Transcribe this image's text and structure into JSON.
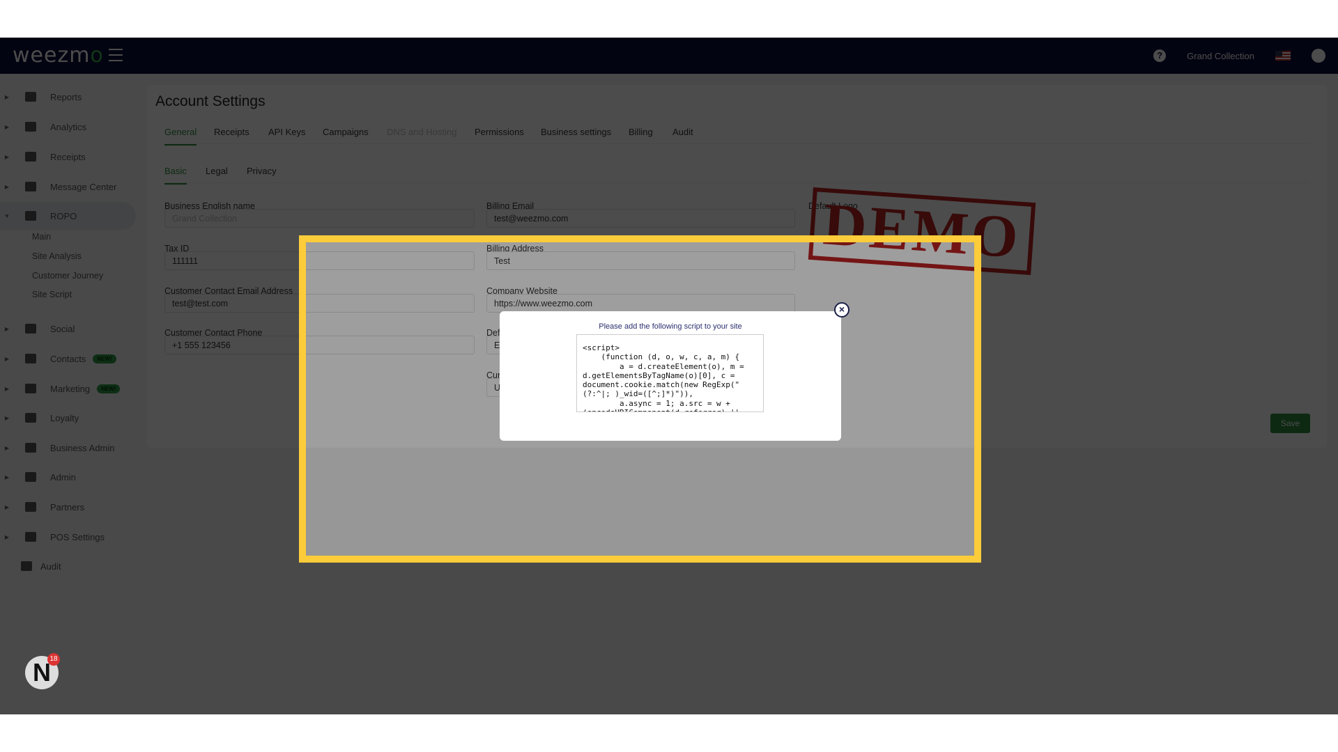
{
  "header": {
    "logo": "weezmo",
    "business": "Grand Collection",
    "icons": [
      "help-icon",
      "us-flag-icon",
      "user-account-icon"
    ]
  },
  "sidebar": {
    "items": [
      {
        "label": "Reports",
        "icon": "dashboard-icon"
      },
      {
        "label": "Analytics",
        "icon": "bar-chart-icon"
      },
      {
        "label": "Receipts",
        "icon": "receipt-icon"
      },
      {
        "label": "Message Center",
        "icon": "chat-icon"
      },
      {
        "label": "ROPO",
        "icon": "infinity-icon",
        "expanded": true,
        "children": [
          "Main",
          "Site Analysis",
          "Customer Journey",
          "Site Script"
        ]
      },
      {
        "label": "Social",
        "icon": "group-icon"
      },
      {
        "label": "Contacts",
        "icon": "contact-icon",
        "badge": "NEW!"
      },
      {
        "label": "Marketing",
        "icon": "party-icon",
        "badge": "NEW!"
      },
      {
        "label": "Loyalty",
        "icon": "tag-heart-icon"
      },
      {
        "label": "Business Admin",
        "icon": "gear-icon"
      },
      {
        "label": "Admin",
        "icon": "gears-icon"
      },
      {
        "label": "Partners",
        "icon": "handshake-icon"
      },
      {
        "label": "POS Settings",
        "icon": "cash-register-icon"
      },
      {
        "label": "Audit",
        "icon": "zoom-icon"
      }
    ]
  },
  "main": {
    "title": "Account Settings",
    "tabs": [
      "General",
      "Receipts",
      "API Keys",
      "Campaigns",
      "DNS and Hosting",
      "Permissions",
      "Business settings",
      "Billing",
      "Audit"
    ],
    "subtabs": [
      "Basic",
      "Legal",
      "Privacy"
    ],
    "fields": {
      "business_name": {
        "label": "Business English name",
        "placeholder": "Grand Collection"
      },
      "tax_id": {
        "label": "Tax ID",
        "value": "111111"
      },
      "contact_email": {
        "label": "Customer Contact Email Address",
        "value": "test@test.com"
      },
      "contact_phone": {
        "label": "Customer Contact Phone",
        "value": "+1 555 123456"
      },
      "billing_email": {
        "label": "Billing Email",
        "value": "test@weezmo.com"
      },
      "billing_address": {
        "label": "Billing Address",
        "value": "Test"
      },
      "website": {
        "label": "Company Website",
        "value": "https://www.weezmo.com"
      },
      "default_x": {
        "label": "Def",
        "value": "E"
      },
      "currency": {
        "label": "Cur",
        "value": "U"
      }
    },
    "default_logo_label": "Default Logo",
    "logo_stamp": "DEMO",
    "save": "Save"
  },
  "modal": {
    "title": "Please add the following script to your site",
    "code": "<script>\n    (function (d, o, w, c, a, m) {\n        a = d.createElement(o), m =\nd.getElementsByTagName(o)[0], c =\ndocument.cookie.match(new RegExp(\"\n(?:^|; )_wid=([^;]*)\")),\n        a.async = 1; a.src = w +\n(encodeURIComponent(d.referrer) ||\nnull); a.referrerPolicy = \"no-",
    "close": "×"
  },
  "notifications": {
    "avatar": "N",
    "count": "18"
  },
  "colors": {
    "header": "#0b0f3a",
    "accent": "#2e8b3f",
    "highlight": "#fdcc3a"
  }
}
